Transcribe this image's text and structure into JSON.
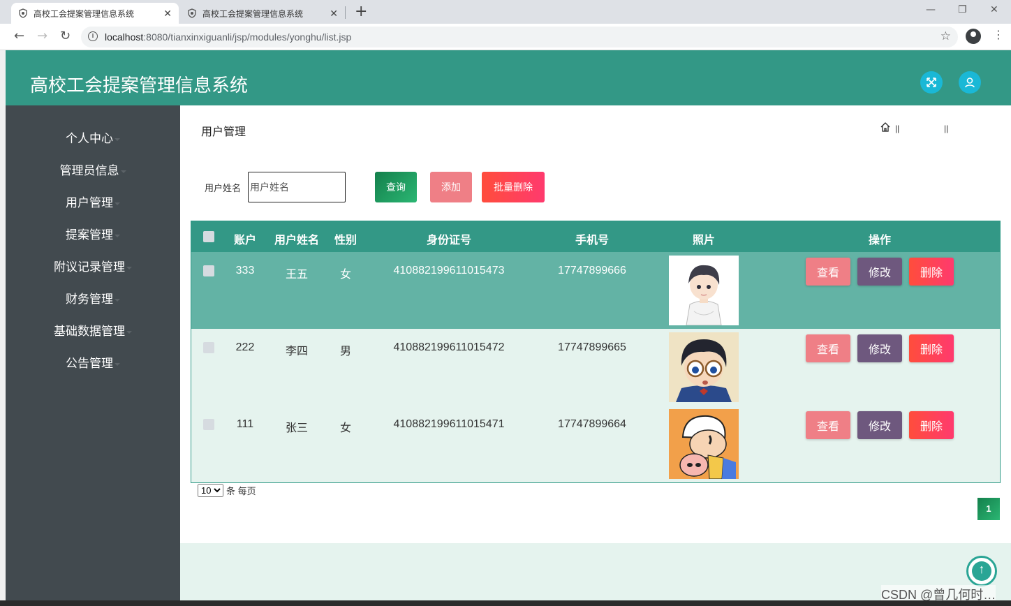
{
  "browser": {
    "tabs": [
      {
        "title": "高校工会提案管理信息系统"
      },
      {
        "title": "高校工会提案管理信息系统"
      }
    ],
    "new_tab": "+",
    "url_host": "localhost",
    "url_rest": ":8080/tianxinxiguanli/jsp/modules/yonghu/list.jsp"
  },
  "header": {
    "title": "高校工会提案管理信息系统"
  },
  "sidebar": {
    "items": [
      {
        "label": "个人中心"
      },
      {
        "label": "管理员信息"
      },
      {
        "label": "用户管理"
      },
      {
        "label": "提案管理"
      },
      {
        "label": "附议记录管理"
      },
      {
        "label": "财务管理"
      },
      {
        "label": "基础数据管理"
      },
      {
        "label": "公告管理"
      }
    ]
  },
  "main": {
    "page_title": "用户管理",
    "breadcrumb_sep": "||",
    "search": {
      "label": "用户姓名",
      "placeholder": "用户姓名",
      "value": ""
    },
    "buttons": {
      "query": "查询",
      "add": "添加",
      "batch_delete": "批量删除"
    },
    "table": {
      "columns": [
        "账户",
        "用户姓名",
        "性别",
        "身份证号",
        "手机号",
        "照片",
        "操作"
      ],
      "rows": [
        {
          "account": "333",
          "name": "王五",
          "gender": "女",
          "id_card": "410882199611015473",
          "phone": "17747899666"
        },
        {
          "account": "222",
          "name": "李四",
          "gender": "男",
          "id_card": "410882199611015472",
          "phone": "17747899665"
        },
        {
          "account": "111",
          "name": "张三",
          "gender": "女",
          "id_card": "410882199611015471",
          "phone": "17747899664"
        }
      ],
      "actions": {
        "view": "查看",
        "edit": "修改",
        "delete": "删除"
      }
    },
    "pager": {
      "page_size": "10",
      "page_size_suffix": "条 每页",
      "current_page": "1"
    }
  },
  "watermark": "CSDN @曾几何时…",
  "colors": {
    "primary": "#339886",
    "sidebar": "#424a4f",
    "row_selected": "#63b3a5",
    "row_light": "#e5f3ee"
  }
}
